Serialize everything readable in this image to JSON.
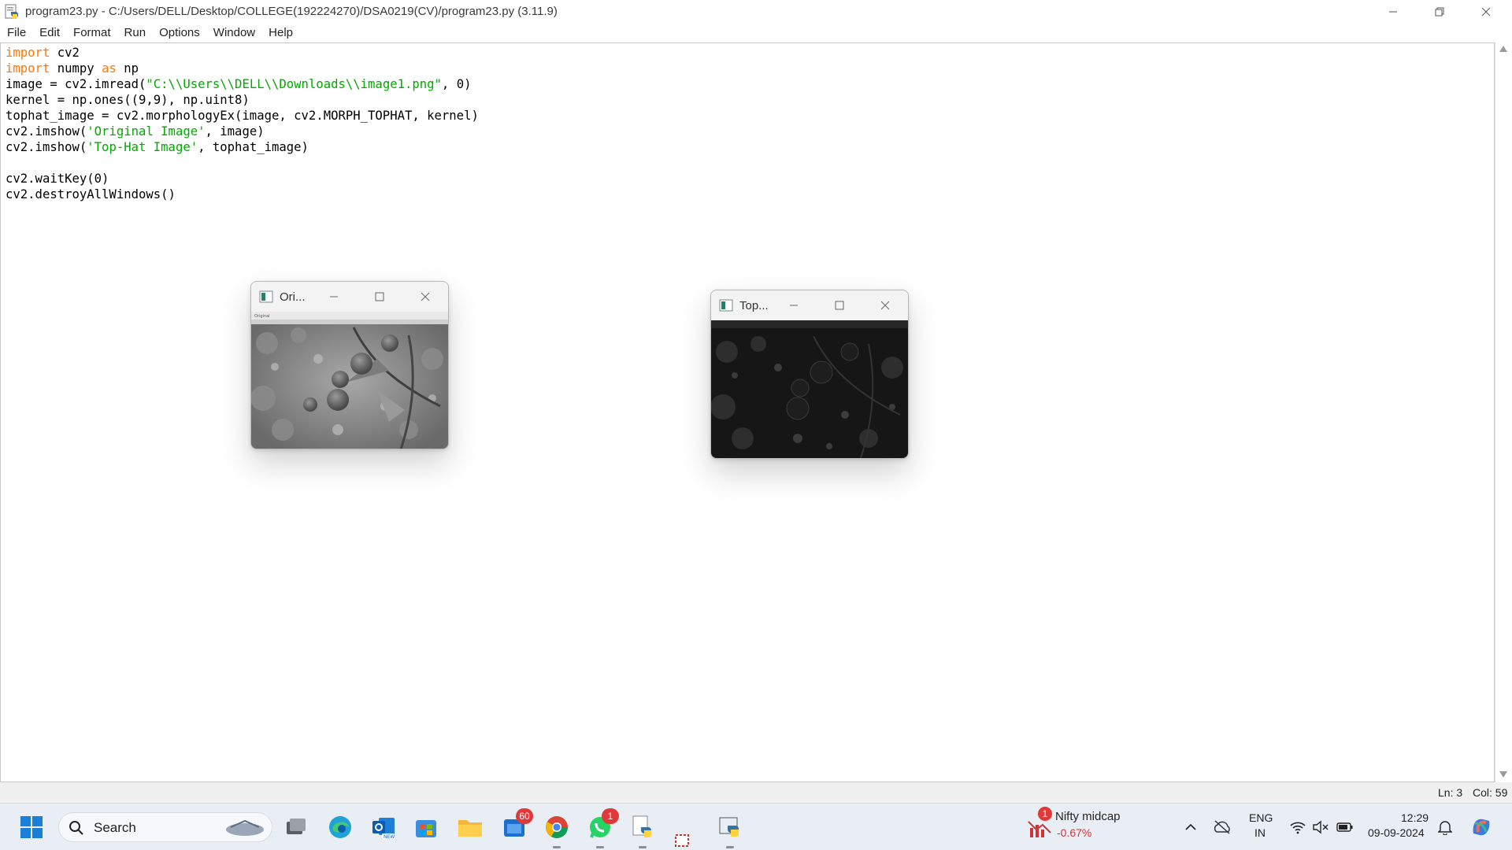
{
  "window": {
    "title": "program23.py - C:/Users/DELL/Desktop/COLLEGE(192224270)/DSA0219(CV)/program23.py (3.11.9)"
  },
  "menu": [
    "File",
    "Edit",
    "Format",
    "Run",
    "Options",
    "Window",
    "Help"
  ],
  "code_lines": [
    [
      {
        "t": "import",
        "c": "kw"
      },
      {
        "t": " cv2",
        "c": ""
      }
    ],
    [
      {
        "t": "import",
        "c": "kw"
      },
      {
        "t": " numpy ",
        "c": ""
      },
      {
        "t": "as",
        "c": "kw"
      },
      {
        "t": " np",
        "c": ""
      }
    ],
    [
      {
        "t": "image = cv2.imread(",
        "c": ""
      },
      {
        "t": "\"C:\\\\Users\\\\DELL\\\\Downloads\\\\image1.png\"",
        "c": "str"
      },
      {
        "t": ", 0)",
        "c": ""
      }
    ],
    [
      {
        "t": "kernel = np.ones((9,9), np.uint8)",
        "c": ""
      }
    ],
    [
      {
        "t": "tophat_image = cv2.morphologyEx(image, cv2.MORPH_TOPHAT, kernel)",
        "c": ""
      }
    ],
    [
      {
        "t": "cv2.imshow(",
        "c": ""
      },
      {
        "t": "'Original Image'",
        "c": "str"
      },
      {
        "t": ", image)",
        "c": ""
      }
    ],
    [
      {
        "t": "cv2.imshow(",
        "c": ""
      },
      {
        "t": "'Top-Hat Image'",
        "c": "str"
      },
      {
        "t": ", tophat_image)",
        "c": ""
      }
    ],
    [],
    [
      {
        "t": "cv2.waitKey(0)",
        "c": ""
      }
    ],
    [
      {
        "t": "cv2.destroyAllWindows()",
        "c": ""
      }
    ]
  ],
  "status": {
    "line": "Ln: 3",
    "col": "Col: 59"
  },
  "cv_windows": [
    {
      "title": "Ori...",
      "image_label": "Original",
      "tone": "light"
    },
    {
      "title": "Top...",
      "image_label": "",
      "tone": "dark"
    }
  ],
  "taskbar": {
    "search_label": "Search",
    "store_badge": "60",
    "whatsapp_badge": "1",
    "widget_badge": "1",
    "widget_title": "Nifty midcap",
    "widget_value": "-0.67%",
    "lang_line1": "ENG",
    "lang_line2": "IN",
    "time": "12:29",
    "date": "09-09-2024"
  },
  "colors": {
    "keyword": "#ff7700",
    "string": "#00aa00",
    "taskbar": "#e9eef5"
  }
}
